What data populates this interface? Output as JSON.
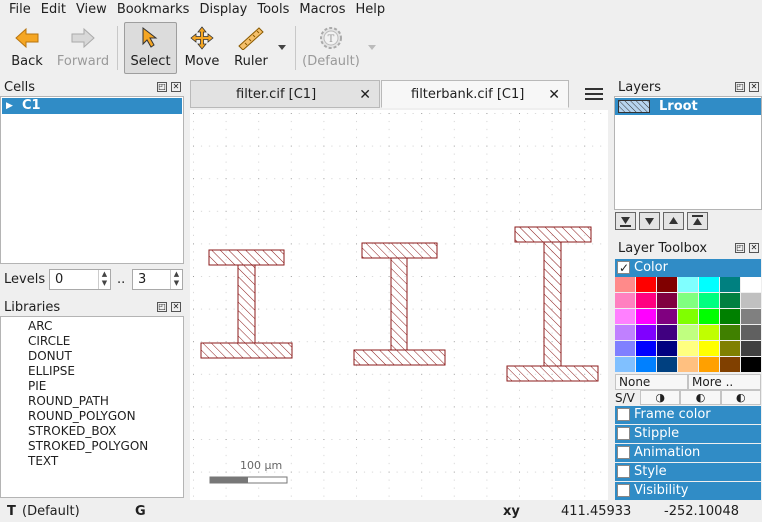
{
  "menu": [
    "File",
    "Edit",
    "View",
    "Bookmarks",
    "Display",
    "Tools",
    "Macros",
    "Help"
  ],
  "toolbar": {
    "back": "Back",
    "forward": "Forward",
    "select": "Select",
    "move": "Move",
    "ruler": "Ruler",
    "default": "(Default)"
  },
  "cells": {
    "title": "Cells",
    "items": [
      "C1"
    ]
  },
  "levels": {
    "label": "Levels",
    "from": "0",
    "sep": "..",
    "to": "3"
  },
  "libraries": {
    "title": "Libraries",
    "items": [
      "ARC",
      "CIRCLE",
      "DONUT",
      "ELLIPSE",
      "PIE",
      "ROUND_PATH",
      "ROUND_POLYGON",
      "STROKED_BOX",
      "STROKED_POLYGON",
      "TEXT"
    ]
  },
  "tabs": [
    {
      "label": "filter.cif [C1]",
      "active": false
    },
    {
      "label": "filterbank.cif [C1]",
      "active": true
    }
  ],
  "canvas": {
    "scale_label": "100 µm"
  },
  "layers": {
    "title": "Layers",
    "items": [
      "Lroot"
    ]
  },
  "toolbox": {
    "title": "Layer Toolbox",
    "color_label": "Color",
    "none_label": "None",
    "more_label": "More ..",
    "sv_label": "S/V",
    "sections": [
      "Frame color",
      "Stipple",
      "Animation",
      "Style",
      "Visibility"
    ],
    "palette": [
      [
        "#ff8a8a",
        "#ff0000",
        "#800000",
        "#80ffff",
        "#00ffff",
        "#008080",
        "#ffffff"
      ],
      [
        "#ff80c0",
        "#ff0080",
        "#800040",
        "#80ff80",
        "#00ff80",
        "#008040",
        "#c0c0c0"
      ],
      [
        "#ff80ff",
        "#ff00ff",
        "#800080",
        "#80ff00",
        "#00ff00",
        "#008000",
        "#808080"
      ],
      [
        "#c080ff",
        "#8000ff",
        "#400080",
        "#c0ff80",
        "#c0ff00",
        "#408000",
        "#606060"
      ],
      [
        "#8080ff",
        "#0000ff",
        "#000080",
        "#ffff80",
        "#ffff00",
        "#808000",
        "#404040"
      ],
      [
        "#80c0ff",
        "#0080ff",
        "#004080",
        "#ffc080",
        "#ffa000",
        "#804000",
        "#000000"
      ]
    ]
  },
  "status": {
    "mode": "T",
    "mode_value": "(Default)",
    "grid": "G",
    "coord_label": "xy",
    "x": "411.45933",
    "y": "-252.10048"
  },
  "colors": {
    "accent": "#308cc6",
    "shape_stroke": "#8b1a1a",
    "grid_dot": "#999999"
  }
}
